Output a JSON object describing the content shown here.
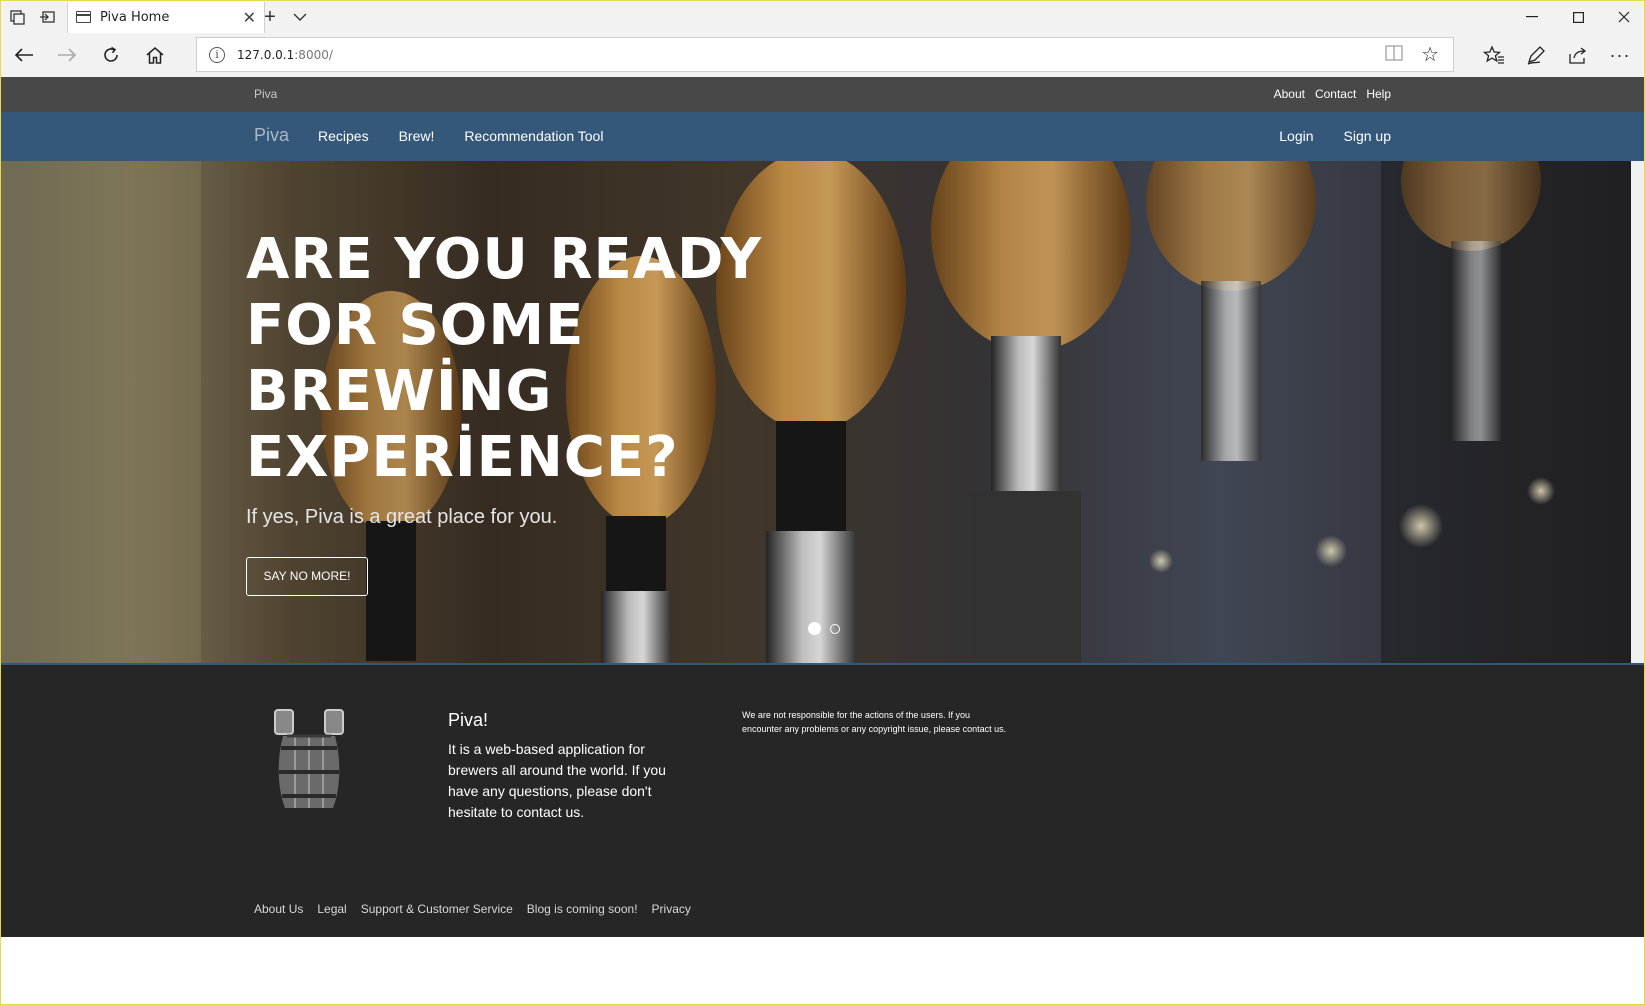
{
  "browser": {
    "tab_title": "Piva Home",
    "address_host": "127.0.0.1",
    "address_rest": ":8000/"
  },
  "topbar": {
    "brand": "Piva",
    "links": [
      "About",
      "Contact",
      "Help"
    ]
  },
  "nav": {
    "brand": "Piva",
    "left_items": [
      "Recipes",
      "Brew!",
      "Recommendation Tool"
    ],
    "right_items": [
      "Login",
      "Sign up"
    ],
    "color": "#35577a"
  },
  "hero": {
    "title_lines": [
      "ARE YOU READY",
      "FOR SOME",
      "BREWİNG",
      "EXPERİENCE?"
    ],
    "subtitle": "If yes, Piva is a great place for you.",
    "button": "SAY NO MORE!",
    "slides": 2,
    "active_slide": 1
  },
  "footer": {
    "title": "Piva!",
    "description": "It is a web-based application for brewers all around the world. If you have any questions, please don't hesitate to contact us.",
    "note": "We are not responsible for the actions of the users. If you encounter any problems or any copyright issue, please contact us.",
    "links": [
      "About Us",
      "Legal",
      "Support & Customer Service",
      "Blog is coming soon!",
      "Privacy"
    ]
  }
}
